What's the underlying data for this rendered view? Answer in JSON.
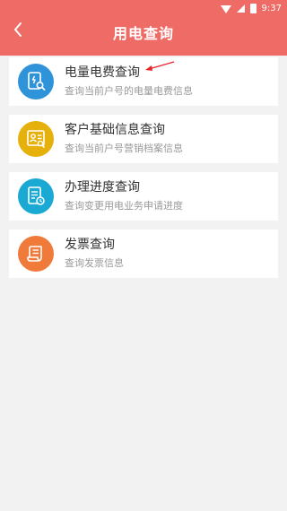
{
  "status": {
    "time": "9:37"
  },
  "header": {
    "title": "用电查询"
  },
  "items": [
    {
      "title": "电量电费查询",
      "subtitle": "查询当前户号的电量电费信息",
      "color": "#2f93d9",
      "icon": "bill-search-icon"
    },
    {
      "title": "客户基础信息查询",
      "subtitle": "查询当前户号营销档案信息",
      "color": "#e6b10c",
      "icon": "profile-card-icon"
    },
    {
      "title": "办理进度查询",
      "subtitle": "查询变更用电业务申请进度",
      "color": "#19a9d3",
      "icon": "progress-clock-icon"
    },
    {
      "title": "发票查询",
      "subtitle": "查询发票信息",
      "color": "#f07a3a",
      "icon": "receipt-icon"
    }
  ],
  "colors": {
    "header": "#ef6b66",
    "background": "#f2f2f2",
    "annotation_arrow": "#e8262a"
  }
}
